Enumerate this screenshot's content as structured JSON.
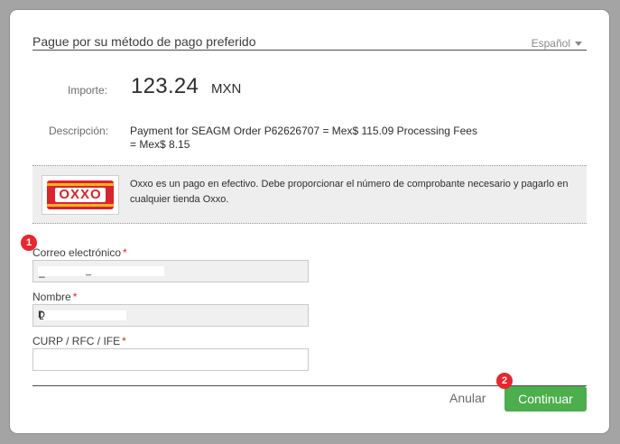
{
  "header": {
    "title": "Pague por su método de pago preferido",
    "language": "Español"
  },
  "summary": {
    "amount_label": "Importe:",
    "amount_value": "123.24",
    "amount_currency": "MXN",
    "description_label": "Descripción:",
    "description_text": "Payment for SEAGM Order P62626707 = Mex$ 115.09 Processing Fees = Mex$ 8.15"
  },
  "payment_method": {
    "logo_text": "OXXO",
    "info": "Oxxo es un pago en efectivo. Debe proporcionar el número de comprobante necesario y pagarlo en cualquier tienda Oxxo."
  },
  "annotations": {
    "badge_1": "1",
    "badge_2": "2"
  },
  "form": {
    "email_label": "Correo electrónico",
    "email_value": "_",
    "name_label": "Nombre",
    "name_value": "D",
    "curp_label": "CURP / RFC / IFE",
    "curp_value": "",
    "required_mark": "*"
  },
  "footer": {
    "cancel_label": "Anular",
    "continue_label": "Continuar"
  },
  "colors": {
    "accent_green": "#4cae4c",
    "required_red": "#d9232d",
    "badge_red": "#e8262d",
    "oxxo_red": "#d9232d",
    "oxxo_yellow": "#f4b223"
  }
}
